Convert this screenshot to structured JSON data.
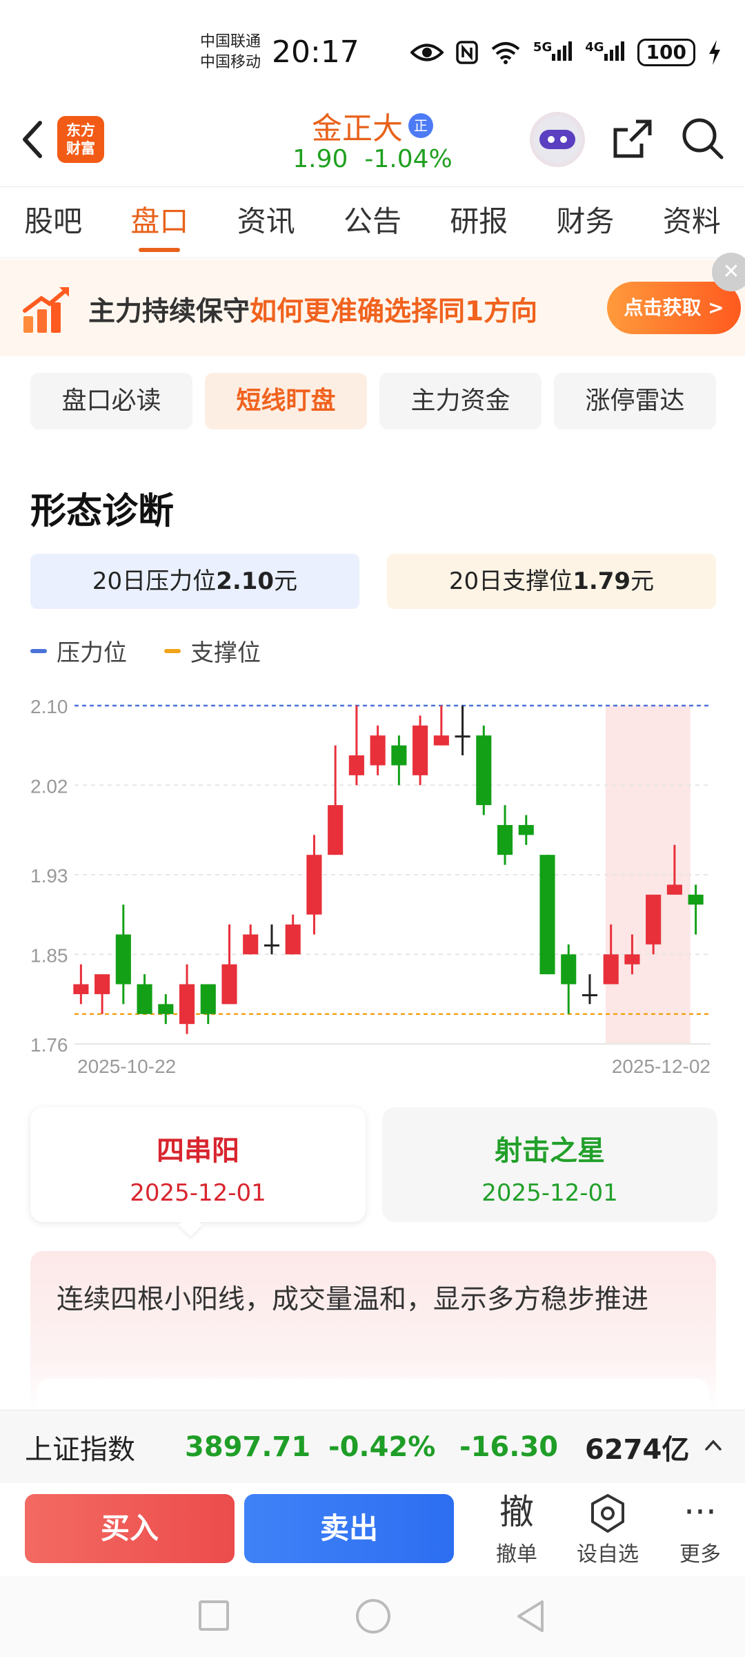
{
  "status_bar": {
    "carrier_1": "中国联通",
    "carrier_2": "中国移动",
    "time": "20:17",
    "signal_1": "5G",
    "signal_2": "4G",
    "battery": "100"
  },
  "header": {
    "logo_line1": "东方",
    "logo_line2": "财富",
    "stock_name": "金正大",
    "badge": "正",
    "price": "1.90",
    "change_pct": "-1.04%"
  },
  "tabs": [
    {
      "label": "股吧",
      "active": false
    },
    {
      "label": "盘口",
      "active": true
    },
    {
      "label": "资讯",
      "active": false
    },
    {
      "label": "公告",
      "active": false
    },
    {
      "label": "研报",
      "active": false
    },
    {
      "label": "财务",
      "active": false
    },
    {
      "label": "资料",
      "active": false
    }
  ],
  "promo": {
    "text_main": "主力持续保守",
    "text_highlight": "如何更准确选择同1方向",
    "button": "点击获取 >",
    "close": "✕"
  },
  "subtabs": [
    {
      "label": "盘口必读",
      "active": false
    },
    {
      "label": "短线盯盘",
      "active": true
    },
    {
      "label": "主力资金",
      "active": false
    },
    {
      "label": "涨停雷达",
      "active": false
    }
  ],
  "section": {
    "title": "形态诊断",
    "resistance_label": "20日压力位",
    "resistance_value": "2.10",
    "resistance_unit": "元",
    "support_label": "20日支撑位",
    "support_value": "1.79",
    "support_unit": "元"
  },
  "legend": {
    "resistance": "压力位",
    "support": "支撑位"
  },
  "colors": {
    "up": "#e8303a",
    "down": "#13a017",
    "flat": "#222222",
    "resistance_line": "#4a72d8",
    "support_line": "#f0a419",
    "accent": "#e8611a"
  },
  "chart_data": {
    "type": "candlestick",
    "x_start_label": "2025-10-22",
    "x_end_label": "2025-12-02",
    "yticks": [
      "2.10",
      "2.02",
      "1.93",
      "1.85",
      "1.76"
    ],
    "ylim": [
      1.76,
      2.1
    ],
    "resistance": 2.1,
    "support": 1.79,
    "highlight_last_n": 4,
    "candles": [
      {
        "o": 1.81,
        "h": 1.84,
        "l": 1.8,
        "c": 1.82
      },
      {
        "o": 1.81,
        "h": 1.83,
        "l": 1.79,
        "c": 1.83
      },
      {
        "o": 1.87,
        "h": 1.9,
        "l": 1.8,
        "c": 1.82
      },
      {
        "o": 1.82,
        "h": 1.83,
        "l": 1.79,
        "c": 1.79
      },
      {
        "o": 1.8,
        "h": 1.81,
        "l": 1.78,
        "c": 1.79
      },
      {
        "o": 1.78,
        "h": 1.84,
        "l": 1.77,
        "c": 1.82
      },
      {
        "o": 1.82,
        "h": 1.82,
        "l": 1.78,
        "c": 1.79
      },
      {
        "o": 1.8,
        "h": 1.88,
        "l": 1.8,
        "c": 1.84
      },
      {
        "o": 1.85,
        "h": 1.88,
        "l": 1.85,
        "c": 1.87
      },
      {
        "o": 1.86,
        "h": 1.88,
        "l": 1.85,
        "c": 1.86
      },
      {
        "o": 1.85,
        "h": 1.89,
        "l": 1.85,
        "c": 1.88
      },
      {
        "o": 1.89,
        "h": 1.97,
        "l": 1.87,
        "c": 1.95
      },
      {
        "o": 1.95,
        "h": 2.06,
        "l": 1.95,
        "c": 2.0
      },
      {
        "o": 2.03,
        "h": 2.1,
        "l": 2.02,
        "c": 2.05
      },
      {
        "o": 2.04,
        "h": 2.08,
        "l": 2.03,
        "c": 2.07
      },
      {
        "o": 2.06,
        "h": 2.07,
        "l": 2.02,
        "c": 2.04
      },
      {
        "o": 2.03,
        "h": 2.09,
        "l": 2.02,
        "c": 2.08
      },
      {
        "o": 2.06,
        "h": 2.1,
        "l": 2.06,
        "c": 2.07
      },
      {
        "o": 2.07,
        "h": 2.1,
        "l": 2.05,
        "c": 2.07
      },
      {
        "o": 2.07,
        "h": 2.08,
        "l": 1.99,
        "c": 2.0
      },
      {
        "o": 1.98,
        "h": 2.0,
        "l": 1.94,
        "c": 1.95
      },
      {
        "o": 1.98,
        "h": 1.99,
        "l": 1.96,
        "c": 1.97
      },
      {
        "o": 1.95,
        "h": 1.95,
        "l": 1.83,
        "c": 1.83
      },
      {
        "o": 1.85,
        "h": 1.86,
        "l": 1.79,
        "c": 1.82
      },
      {
        "o": 1.81,
        "h": 1.83,
        "l": 1.8,
        "c": 1.81
      },
      {
        "o": 1.82,
        "h": 1.88,
        "l": 1.82,
        "c": 1.85
      },
      {
        "o": 1.84,
        "h": 1.87,
        "l": 1.83,
        "c": 1.85
      },
      {
        "o": 1.86,
        "h": 1.91,
        "l": 1.85,
        "c": 1.91
      },
      {
        "o": 1.91,
        "h": 1.96,
        "l": 1.91,
        "c": 1.92
      },
      {
        "o": 1.91,
        "h": 1.92,
        "l": 1.87,
        "c": 1.9
      }
    ]
  },
  "patterns": [
    {
      "name": "四串阳",
      "date": "2025-12-01"
    },
    {
      "name": "射击之星",
      "date": "2025-12-01"
    }
  ],
  "description": "连续四根小阳线，成交量温和，显示多方稳步推进",
  "index_bar": {
    "name": "上证指数",
    "value": "3897.71",
    "change_pct": "-0.42%",
    "change": "-16.30",
    "amount": "6274亿"
  },
  "actions": {
    "buy": "买入",
    "sell": "卖出",
    "cancel_glyph": "撤",
    "cancel_label": "撤单",
    "watch_label": "设自选",
    "more_glyph": "···",
    "more_label": "更多"
  }
}
